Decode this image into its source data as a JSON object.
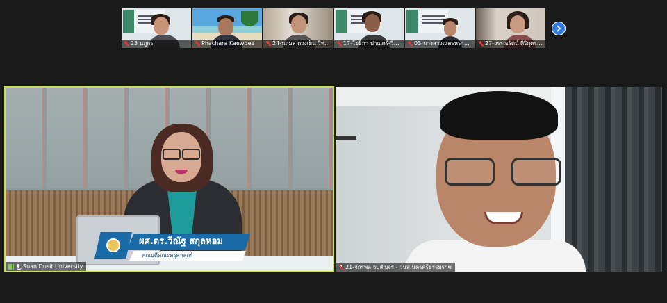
{
  "thumbnails": [
    {
      "name": "23 นภูกร",
      "muted": true,
      "kind": "slide-woman"
    },
    {
      "name": "Phachara Kaewdee",
      "muted": true,
      "kind": "beach-man"
    },
    {
      "name": "24-นฤมล ดวงเย็น วิทยาลัย...",
      "muted": true,
      "kind": "room-woman"
    },
    {
      "name": "17-โยธิกา ปาณศรี-วิทยาลั...",
      "muted": true,
      "kind": "slide-woman"
    },
    {
      "name": "03-นางสาวณตรหราย ย่อย...",
      "muted": true,
      "kind": "slide-man"
    },
    {
      "name": "27-วรรณรัตน์ ศิริกุศร-วข...",
      "muted": true,
      "kind": "room-woman"
    }
  ],
  "next_button": {
    "icon": "chevron-right-icon"
  },
  "main_left": {
    "participant_label": "Suan Dusit University",
    "lower_third_name": "ผศ.ดร.วีณัฐ สกุลหอม",
    "lower_third_title": "คณบดีคณะครุศาสตร์",
    "highlight_color": "#c8e04a",
    "accent_color": "#1b6aa8"
  },
  "main_right": {
    "participant_label": "21-จักรพล จบสัญจร - วนส.นครศรีธรรมราช"
  }
}
